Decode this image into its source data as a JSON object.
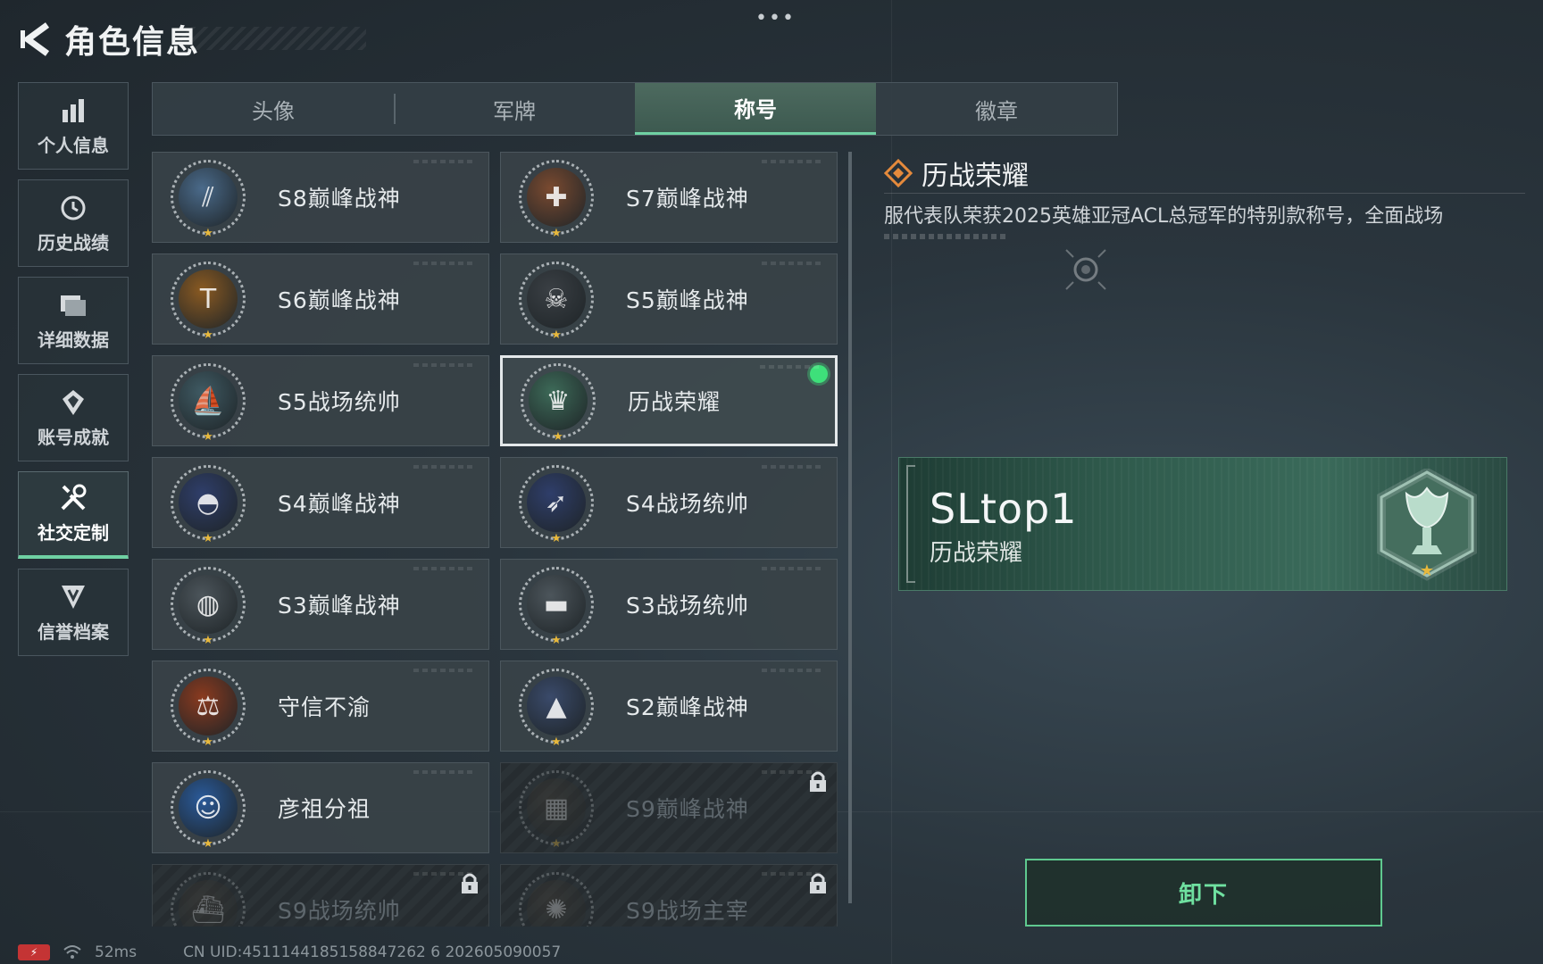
{
  "header": {
    "title": "角色信息",
    "more": "•••"
  },
  "sidebar": {
    "items": [
      {
        "label": "个人信息",
        "icon": "bar-chart-icon",
        "active": false
      },
      {
        "label": "历史战绩",
        "icon": "history-icon",
        "active": false
      },
      {
        "label": "详细数据",
        "icon": "folder-icon",
        "active": false
      },
      {
        "label": "账号成就",
        "icon": "achievement-icon",
        "active": false
      },
      {
        "label": "社交定制",
        "icon": "tools-icon",
        "active": true
      },
      {
        "label": "信誉档案",
        "icon": "shield-icon",
        "active": false
      }
    ]
  },
  "tabs": [
    {
      "label": "头像",
      "active": false
    },
    {
      "label": "军牌",
      "active": false
    },
    {
      "label": "称号",
      "active": true
    },
    {
      "label": "徽章",
      "active": false
    }
  ],
  "titles": [
    {
      "name": "S8巅峰战神",
      "icon": "stripes-emblem-icon",
      "color": "#4a6a8a",
      "locked": false
    },
    {
      "name": "S7巅峰战神",
      "icon": "crossbow-emblem-icon",
      "color": "#7a4a30",
      "locked": false
    },
    {
      "name": "S6巅峰战神",
      "icon": "t-emblem-icon",
      "color": "#8a5a22",
      "locked": false
    },
    {
      "name": "S5巅峰战神",
      "icon": "skull-emblem-icon",
      "color": "#3a3f44",
      "locked": false
    },
    {
      "name": "S5战场统帅",
      "icon": "boat-emblem-icon",
      "color": "#3f5a63",
      "locked": false
    },
    {
      "name": "历战荣耀",
      "icon": "trophy-emblem-icon",
      "color": "#3d6a58",
      "locked": false,
      "selected": true
    },
    {
      "name": "S4巅峰战神",
      "icon": "helmet-emblem-icon",
      "color": "#2f3e6a",
      "locked": false
    },
    {
      "name": "S4战场统帅",
      "icon": "missile-emblem-icon",
      "color": "#2f3e6a",
      "locked": false
    },
    {
      "name": "S3巅峰战神",
      "icon": "globe-emblem-icon",
      "color": "#4c555b",
      "locked": false
    },
    {
      "name": "S3战场统帅",
      "icon": "tank-emblem-icon",
      "color": "#4c555b",
      "locked": false
    },
    {
      "name": "守信不渝",
      "icon": "scales-emblem-icon",
      "color": "#8a3a1f",
      "locked": false
    },
    {
      "name": "S2巅峰战神",
      "icon": "triangle-emblem-icon",
      "color": "#3a4a6a",
      "locked": false
    },
    {
      "name": "彦祖分祖",
      "icon": "portrait-emblem-icon",
      "color": "#2a5a9a",
      "locked": false
    },
    {
      "name": "S9巅峰战神",
      "icon": "building-emblem-icon",
      "color": "#4a4238",
      "locked": true
    },
    {
      "name": "S9战场统帅",
      "icon": "ship-emblem-icon",
      "color": "#4a4238",
      "locked": true
    },
    {
      "name": "S9战场主宰",
      "icon": "explosion-emblem-icon",
      "color": "#4a4238",
      "locked": true
    }
  ],
  "detail": {
    "title": "历战荣耀",
    "description": "服代表队荣获2025英雄亚冠ACL总冠军的特别款称号，全面战场",
    "banner_name": "SLtop1",
    "banner_title": "历战荣耀",
    "unequip_label": "卸下"
  },
  "status": {
    "battery": "⚡",
    "ping": "52ms",
    "uid": "CN UID:4511144185158847262 6 202605090057"
  },
  "colors": {
    "accent": "#6fd1a3",
    "equipped": "#3ee07a",
    "star": "#e7b83c"
  }
}
